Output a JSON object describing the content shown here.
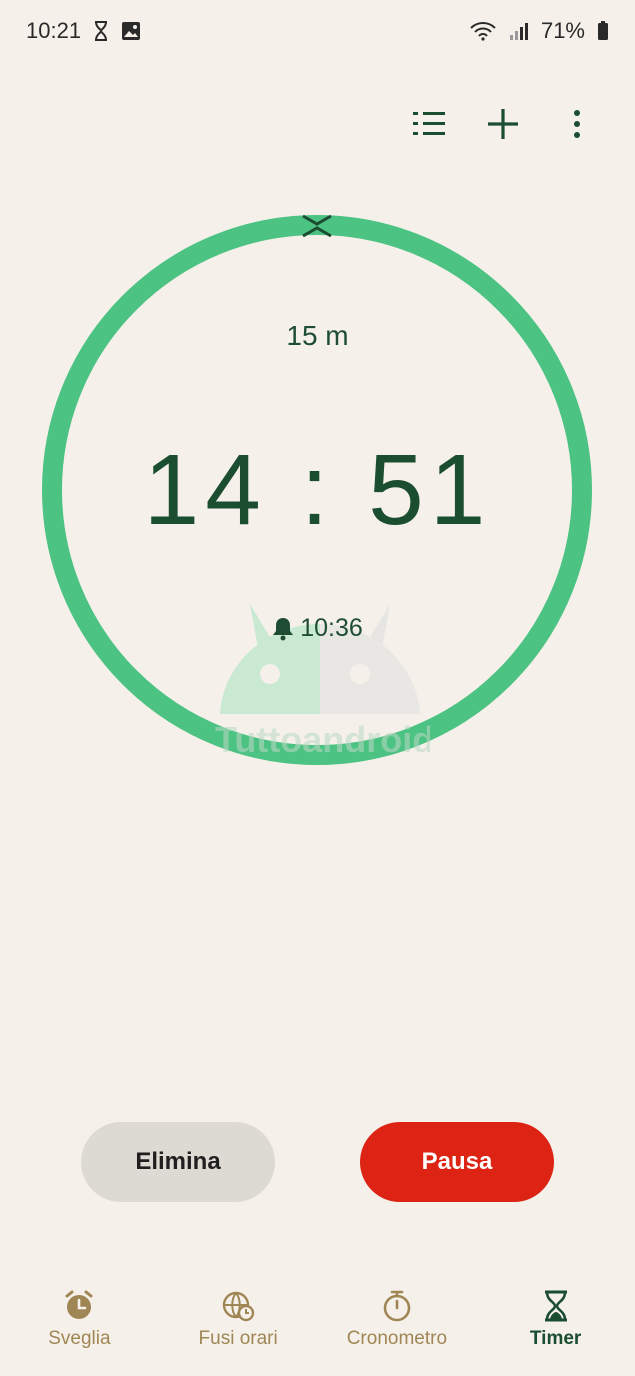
{
  "status_bar": {
    "time": "10:21",
    "battery": "71%",
    "icons": [
      "hourglass-icon",
      "image-icon",
      "wifi-icon",
      "signal-icon",
      "battery-icon"
    ]
  },
  "toolbar": {
    "icons": [
      "list-icon",
      "plus-icon",
      "more-vert-icon"
    ]
  },
  "timer": {
    "label": "15 m",
    "remaining": "14 : 51",
    "end_time": "10:36",
    "progress": 0.99
  },
  "buttons": {
    "delete": "Elimina",
    "pause": "Pausa"
  },
  "nav": {
    "items": [
      {
        "label": "Sveglia",
        "icon": "alarm-clock-icon"
      },
      {
        "label": "Fusi orari",
        "icon": "globe-clock-icon"
      },
      {
        "label": "Cronometro",
        "icon": "stopwatch-icon"
      },
      {
        "label": "Timer",
        "icon": "hourglass-icon"
      }
    ],
    "active": "Timer"
  },
  "colors": {
    "background": "#f5f1ea",
    "ring": "#4cc283",
    "text_green": "#1b4d30",
    "pause": "#dc2314",
    "delete": "#dddad3",
    "nav_inactive": "#a08654"
  },
  "watermark": "Tuttoandroid"
}
